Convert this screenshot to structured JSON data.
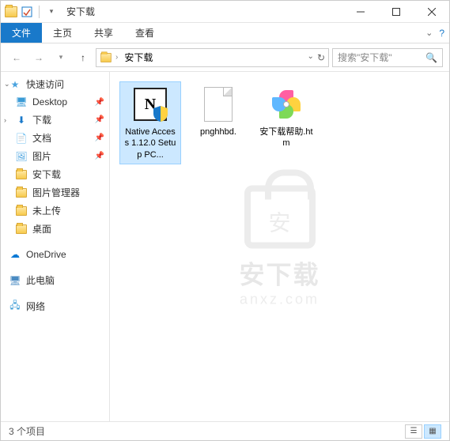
{
  "window": {
    "title": "安下载"
  },
  "ribbon": {
    "file": "文件",
    "home": "主页",
    "share": "共享",
    "view": "查看"
  },
  "address": {
    "crumbs": [
      "安下载"
    ]
  },
  "search": {
    "placeholder": "搜索\"安下载\""
  },
  "sidebar": {
    "quick_access": "快速访问",
    "items": [
      {
        "label": "Desktop",
        "icon": "desktop",
        "pinned": true
      },
      {
        "label": "下载",
        "icon": "download",
        "pinned": true,
        "expandable": true
      },
      {
        "label": "文档",
        "icon": "document",
        "pinned": true
      },
      {
        "label": "图片",
        "icon": "picture",
        "pinned": true
      },
      {
        "label": "安下载",
        "icon": "folder"
      },
      {
        "label": "图片管理器",
        "icon": "folder"
      },
      {
        "label": "未上传",
        "icon": "folder"
      },
      {
        "label": "桌面",
        "icon": "folder"
      }
    ],
    "onedrive": "OneDrive",
    "thispc": "此电脑",
    "network": "网络"
  },
  "files": [
    {
      "name": "Native Access 1.12.0 Setup PC...",
      "type": "exe",
      "selected": true
    },
    {
      "name": "pnghhbd.",
      "type": "blank"
    },
    {
      "name": "安下载帮助.htm",
      "type": "htm"
    }
  ],
  "watermark": {
    "line1": "安下载",
    "line2": "anxz.com"
  },
  "status": {
    "text": "3 个项目"
  }
}
